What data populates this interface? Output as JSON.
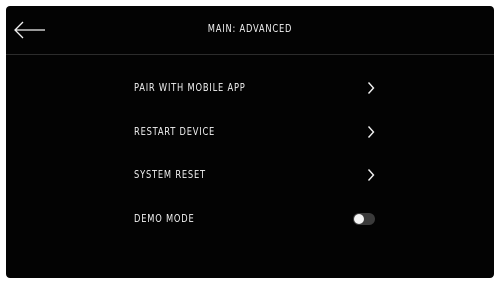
{
  "header": {
    "title": "MAIN: ADVANCED",
    "back_icon": "arrow-left-icon"
  },
  "menu": {
    "items": [
      {
        "label": "PAIR WITH MOBILE APP",
        "control": "chevron-right-icon"
      },
      {
        "label": "RESTART DEVICE",
        "control": "chevron-right-icon"
      },
      {
        "label": "SYSTEM RESET",
        "control": "chevron-right-icon"
      },
      {
        "label": "DEMO MODE",
        "control": "toggle",
        "toggle_on": false
      }
    ]
  },
  "colors": {
    "background": "#030303",
    "text": "#f2f2f2",
    "divider": "#2c2c2c",
    "toggle_track": "#3a3a3a",
    "toggle_knob": "#f4f4f4"
  }
}
